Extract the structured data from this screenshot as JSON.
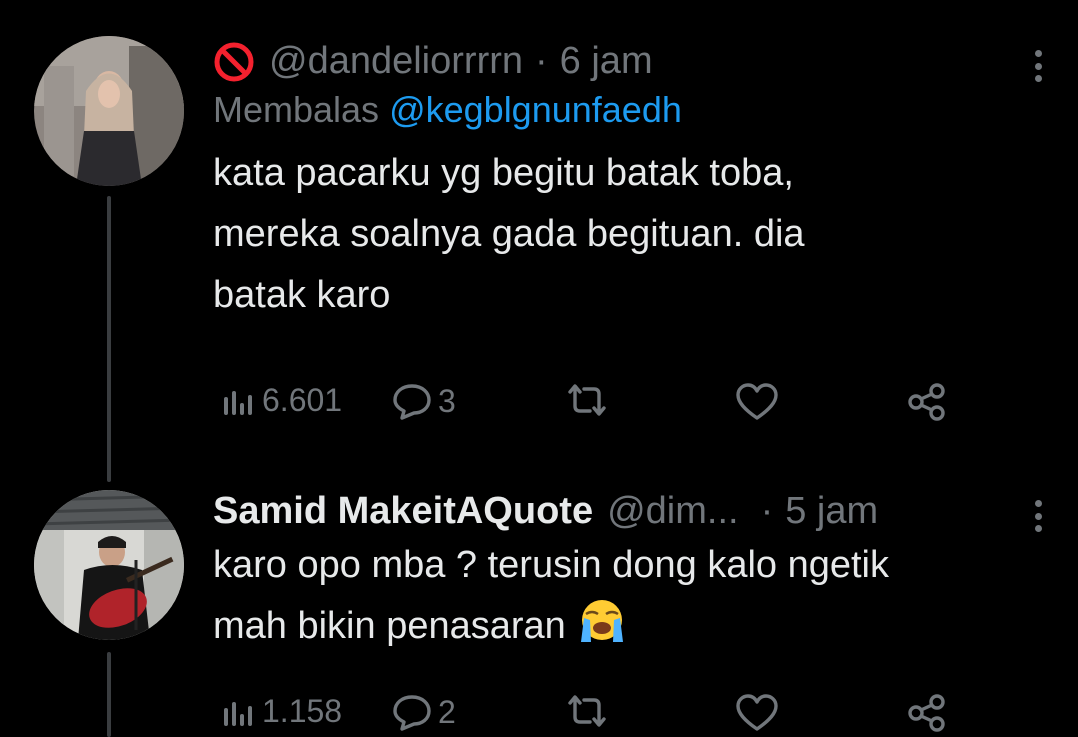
{
  "tweets": [
    {
      "author_handle": "@dandeliorrrrn",
      "separator": "·",
      "time": "6 jam",
      "reply_prefix": "Membalas",
      "reply_mention": "@kegblgnunfaedh",
      "text_lines": [
        "kata pacarku yg begitu batak toba,",
        "mereka soalnya gada begituan. dia",
        "batak karo"
      ],
      "views": "6.601",
      "replies": "3"
    },
    {
      "author_name": "Samid MakeitAQuote",
      "author_handle": "@dim...",
      "separator": "·",
      "time": "5 jam",
      "text_lines": [
        "karo opo mba ? terusin dong kalo ngetik",
        "mah bikin penasaran"
      ],
      "emoji": "loudly-crying-face",
      "views": "1.158",
      "replies": "2"
    }
  ],
  "colors": {
    "background": "#000000",
    "text": "#e7e9ea",
    "secondary": "#71767b",
    "mention": "#1d9bf0",
    "blocked": "#f4212e",
    "thread_line": "#3a3d40"
  }
}
